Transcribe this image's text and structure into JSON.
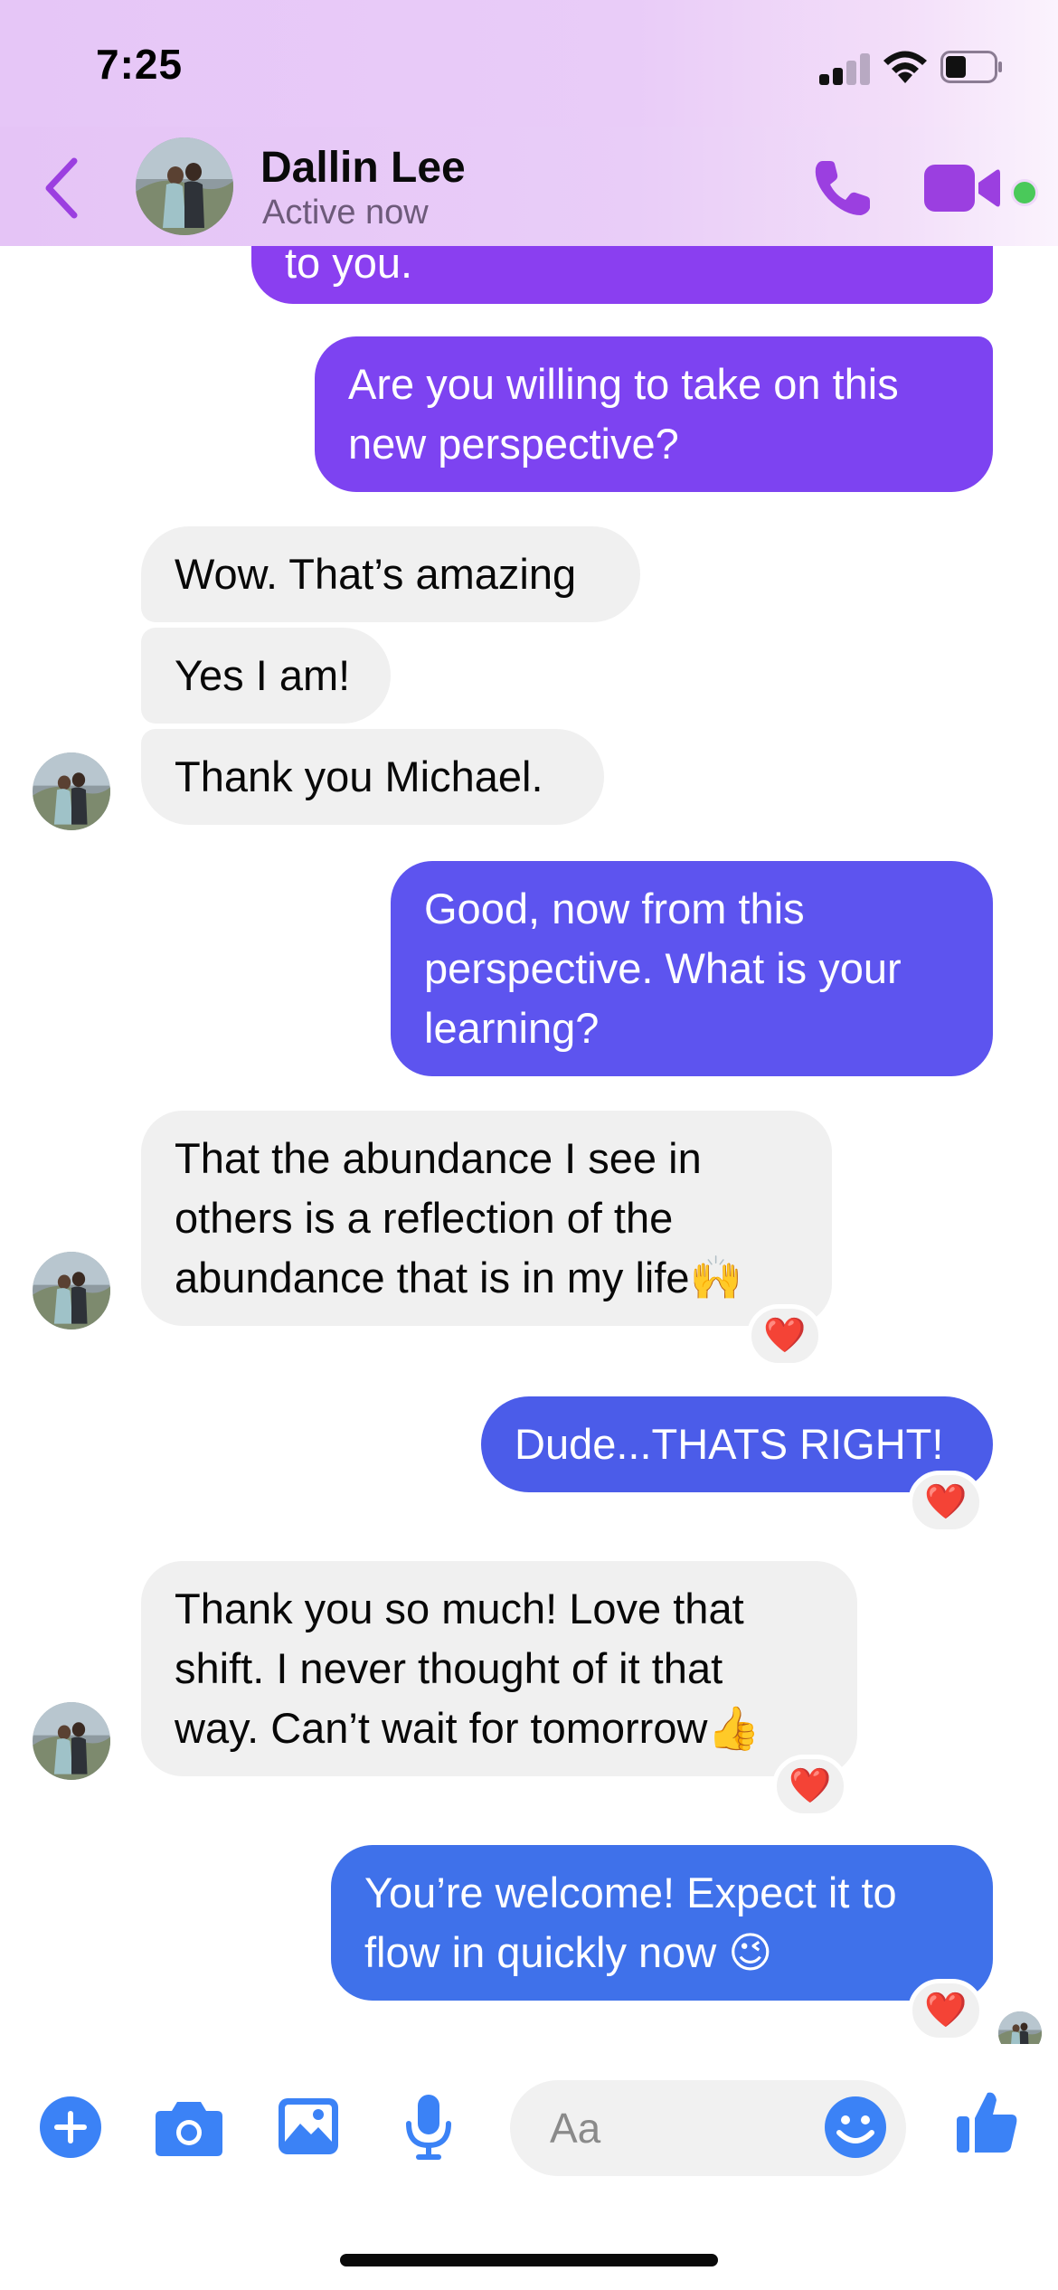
{
  "status_bar": {
    "time": "7:25"
  },
  "header": {
    "contact_name": "Dallin Lee",
    "contact_status": "Active now",
    "icons": [
      "back-chevron-icon",
      "phone-icon",
      "video-camera-icon"
    ],
    "accent_color": "#9b3fe0"
  },
  "messages": [
    {
      "direction": "out",
      "text": "to you.",
      "color": "#8a3ff0"
    },
    {
      "direction": "out",
      "lines": [
        "Are you willing to take on this",
        "new perspective?"
      ],
      "color": "#7d43f1"
    },
    {
      "direction": "in",
      "text": "Wow. That’s amazing"
    },
    {
      "direction": "in",
      "text": "Yes I am!"
    },
    {
      "direction": "in",
      "text": "Thank you Michael."
    },
    {
      "direction": "out",
      "lines": [
        "Good, now from this",
        "perspective. What is your",
        "learning?"
      ],
      "color": "#5d54ef"
    },
    {
      "direction": "in",
      "lines": [
        "That the abundance I see in",
        "others is a reflection of the",
        "abundance that is in my life🙌"
      ],
      "reaction": "❤️"
    },
    {
      "direction": "out",
      "text": "Dude...THATS RIGHT!",
      "color": "#4b5ce9",
      "reaction": "❤️"
    },
    {
      "direction": "in",
      "lines": [
        "Thank you so much! Love that",
        "shift. I never thought of it that",
        "way. Can’t wait for tomorrow👍"
      ],
      "reaction": "❤️"
    },
    {
      "direction": "out",
      "lines": [
        "You’re welcome! Expect it to",
        "flow in quickly now 😉"
      ],
      "color": "#3f71ea",
      "reaction": "❤️"
    }
  ],
  "composer": {
    "placeholder": "Aa",
    "icons": [
      "plus-icon",
      "camera-icon",
      "photo-icon",
      "microphone-icon",
      "emoji-icon",
      "thumbs-up-icon"
    ],
    "icon_color": "#3b82f6"
  }
}
